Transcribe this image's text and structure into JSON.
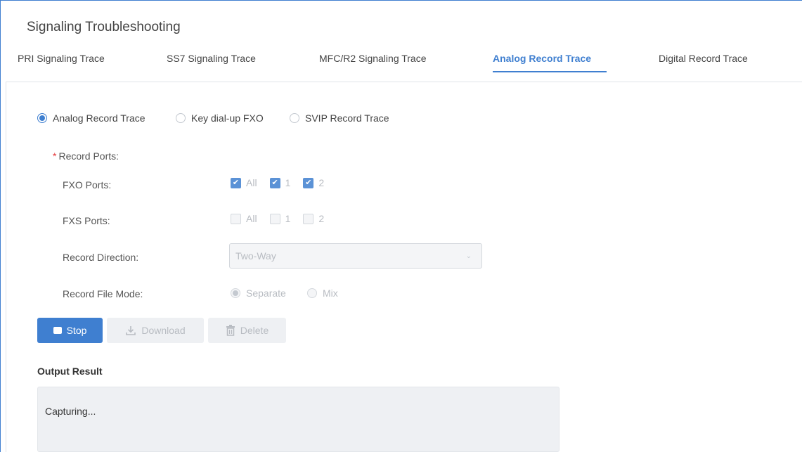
{
  "page": {
    "title": "Signaling Troubleshooting"
  },
  "tabs": [
    {
      "label": "PRI Signaling Trace",
      "active": false
    },
    {
      "label": "SS7 Signaling Trace",
      "active": false
    },
    {
      "label": "MFC/R2 Signaling Trace",
      "active": false
    },
    {
      "label": "Analog Record Trace",
      "active": true
    },
    {
      "label": "Digital Record Trace",
      "active": false
    }
  ],
  "trace_mode": {
    "options": [
      "Analog Record Trace",
      "Key dial-up FXO",
      "SVIP Record Trace"
    ],
    "selected": "Analog Record Trace"
  },
  "form": {
    "record_ports_label": "Record Ports",
    "record_ports_suffix": ":",
    "required_mark": "*",
    "fxo": {
      "label": "FXO Ports",
      "suffix": ":",
      "options": [
        {
          "label": "All",
          "checked": true
        },
        {
          "label": "1",
          "checked": true
        },
        {
          "label": "2",
          "checked": true
        }
      ]
    },
    "fxs": {
      "label": "FXS Ports",
      "suffix": ":",
      "options": [
        {
          "label": "All",
          "checked": false
        },
        {
          "label": "1",
          "checked": false
        },
        {
          "label": "2",
          "checked": false
        }
      ]
    },
    "record_direction": {
      "label": "Record Direction",
      "suffix": ":",
      "value": "Two-Way"
    },
    "record_file_mode": {
      "label": "Record File Mode",
      "suffix": ":",
      "options": [
        "Separate",
        "Mix"
      ],
      "selected": "Separate"
    }
  },
  "actions": {
    "stop": "Stop",
    "download": "Download",
    "delete": "Delete"
  },
  "output": {
    "label": "Output Result",
    "text": "Capturing..."
  },
  "colors": {
    "accent": "#3f7fd0",
    "required": "#e4393c",
    "disabled_text": "#b8bcc2",
    "disabled_bg": "#eef0f3"
  }
}
